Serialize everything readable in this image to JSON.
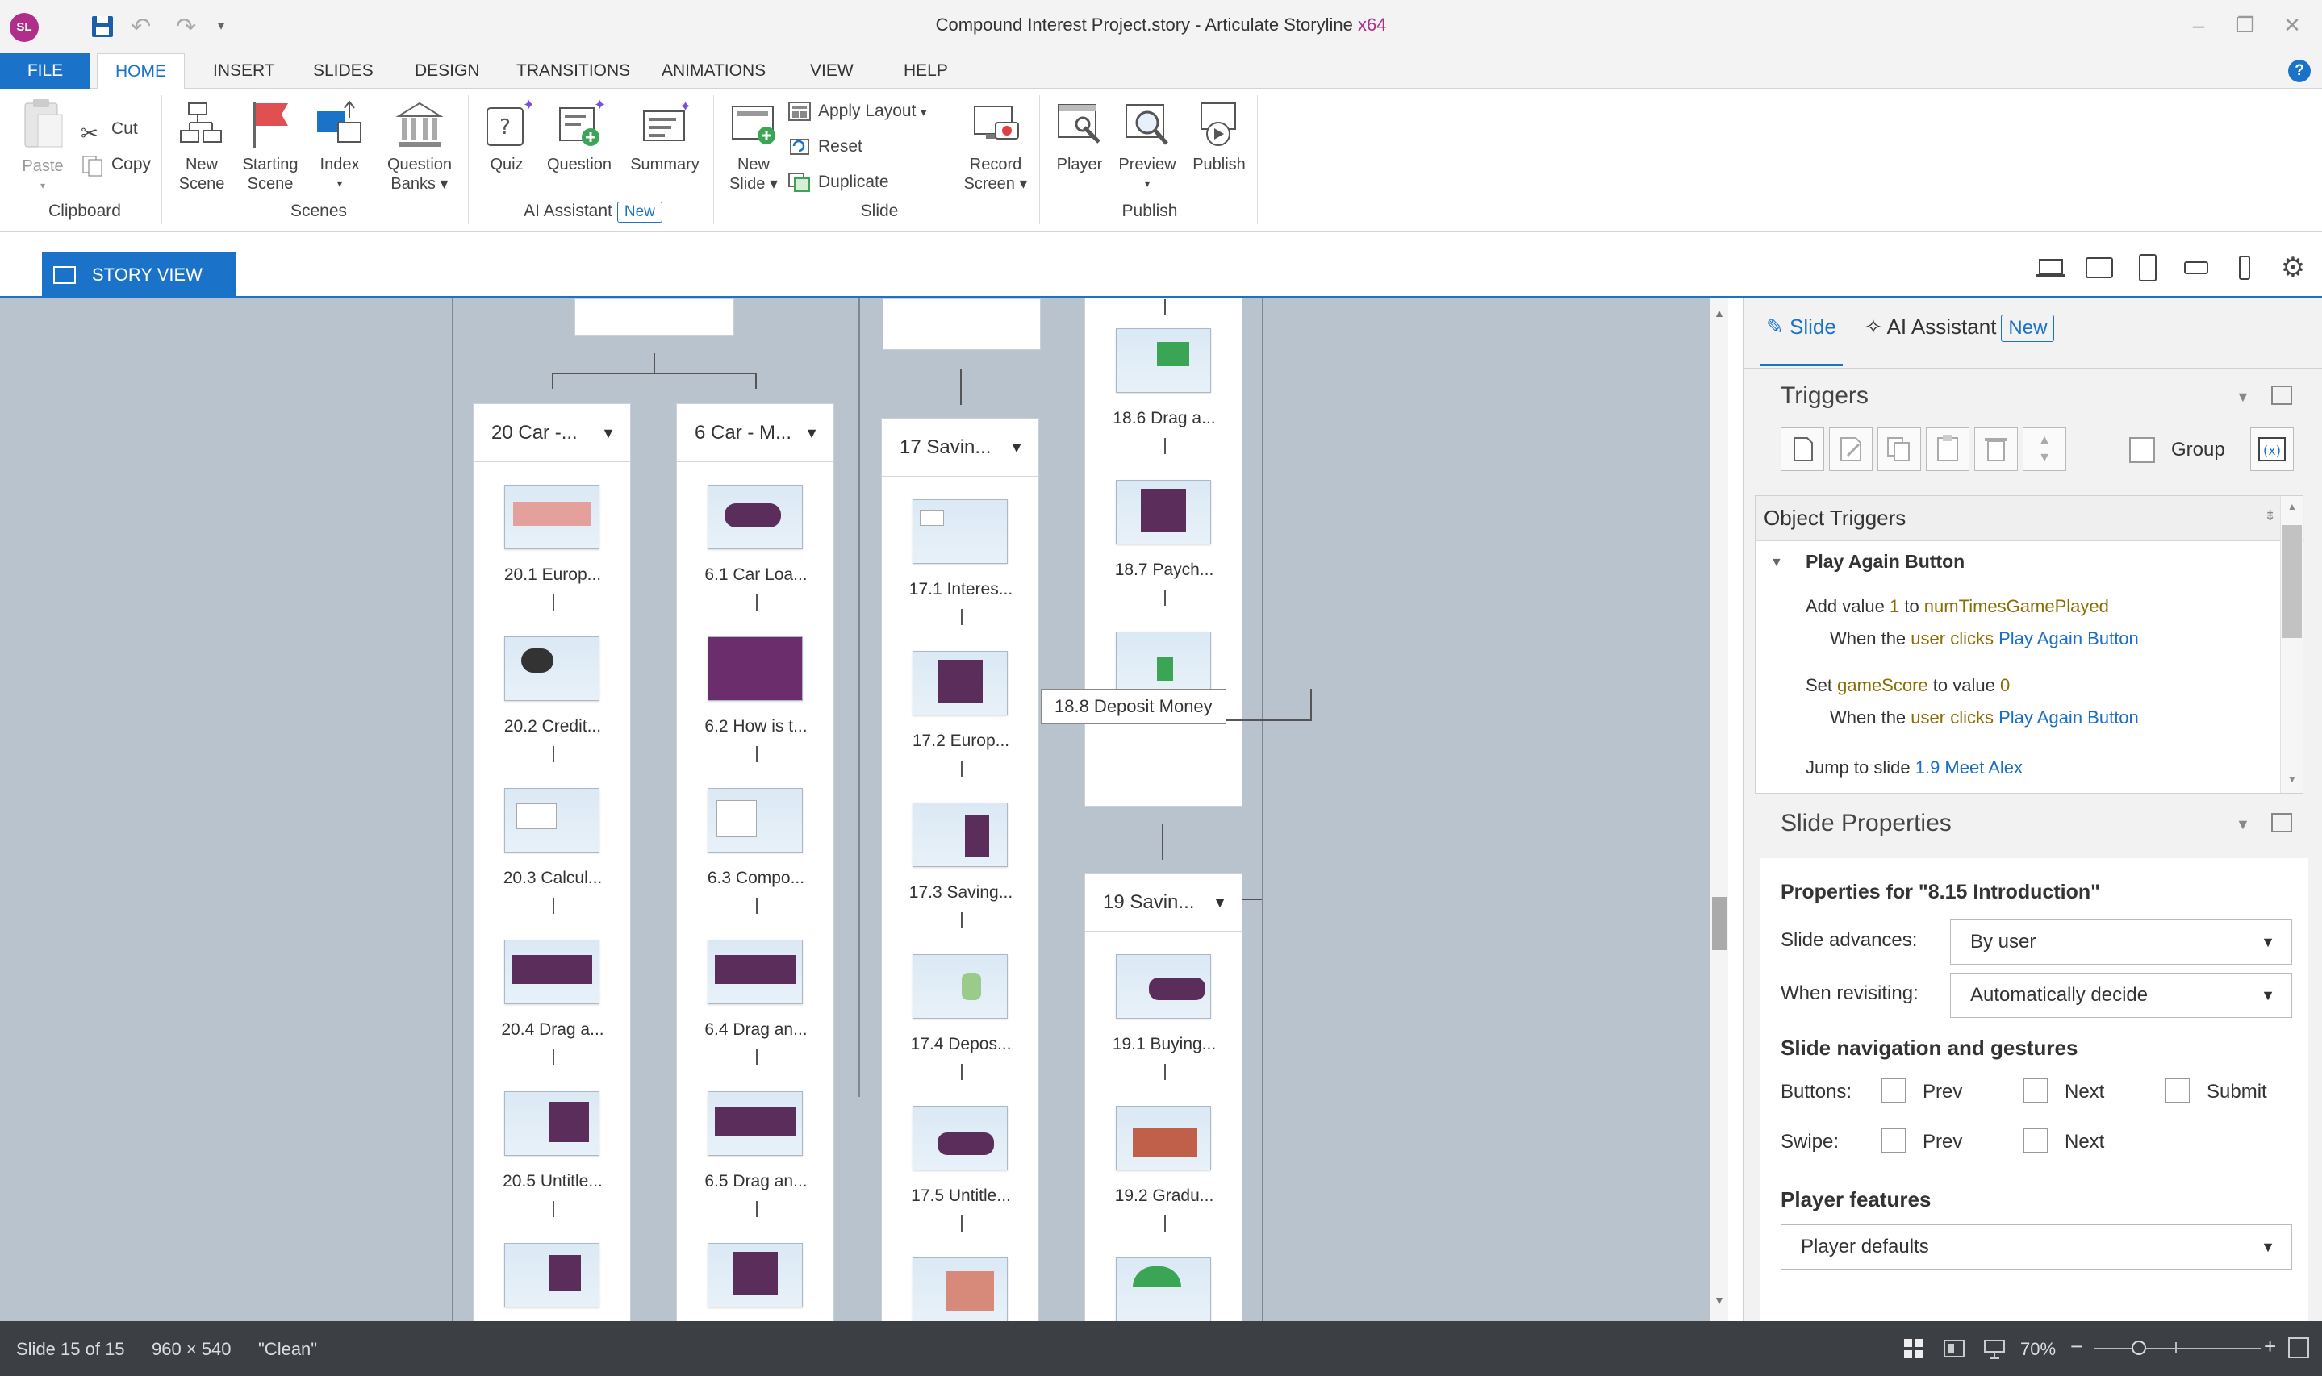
{
  "app": {
    "logo_text": "SL",
    "title_main": "Compound Interest Project.story - ",
    "title_app": "Articulate Storyline ",
    "title_arch": "x64",
    "accent": "#1a73c9",
    "brand": "#b12d8a"
  },
  "tabs": {
    "file": "FILE",
    "home": "HOME",
    "insert": "INSERT",
    "slides": "SLIDES",
    "design": "DESIGN",
    "transitions": "TRANSITIONS",
    "animations": "ANIMATIONS",
    "view": "VIEW",
    "help": "HELP"
  },
  "ribbon": {
    "clipboard": {
      "paste": "Paste",
      "cut": "Cut",
      "copy": "Copy",
      "label": "Clipboard"
    },
    "scenes": {
      "new1": "New",
      "new2": "Scene",
      "start1": "Starting",
      "start2": "Scene",
      "index": "Index",
      "qb1": "Question",
      "qb2": "Banks",
      "label": "Scenes"
    },
    "ai": {
      "quiz": "Quiz",
      "question": "Question",
      "summary": "Summary",
      "label": "AI Assistant",
      "badge": "New"
    },
    "slide": {
      "new1": "New",
      "new2": "Slide",
      "apply_layout": "Apply Layout",
      "reset": "Reset",
      "duplicate": "Duplicate",
      "record1": "Record",
      "record2": "Screen",
      "label": "Slide"
    },
    "publish": {
      "player": "Player",
      "preview": "Preview",
      "publish": "Publish",
      "label": "Publish"
    }
  },
  "viewtab": {
    "story_view": "STORY VIEW"
  },
  "scenes": [
    {
      "title": "20 Car -...",
      "slides": [
        "20.1 Europ...",
        "20.2 Credit...",
        "20.3 Calcul...",
        "20.4 Drag a...",
        "20.5 Untitle..."
      ]
    },
    {
      "title": "6 Car - M...",
      "slides": [
        "6.1 Car Loa...",
        "6.2 How is t...",
        "6.3 Compo...",
        "6.4 Drag an...",
        "6.5 Drag an..."
      ]
    },
    {
      "title": "17 Savin...",
      "slides": [
        "17.1 Interes...",
        "17.2 Europ...",
        "17.3 Saving...",
        "17.4 Depos...",
        "17.5 Untitle..."
      ]
    },
    {
      "title": "",
      "slides": [
        "18.6 Drag a...",
        "18.7 Paych..."
      ]
    },
    {
      "title": "19 Savin...",
      "slides": [
        "19.1  Buying...",
        "19.2 Gradu..."
      ]
    }
  ],
  "tooltip": "18.8 Deposit Money",
  "panel": {
    "tab_slide": "Slide",
    "tab_ai": "AI Assistant",
    "tab_ai_badge": "New",
    "triggers_title": "Triggers",
    "group_label": "Group",
    "object_triggers": "Object Triggers",
    "object_name": "Play Again Button",
    "t1_action": "Add value ",
    "t1_num": "1",
    "t1_to": " to ",
    "t1_var": "numTimesGamePlayed",
    "t1_when": "When the ",
    "t1_user": "user clicks",
    "t1_obj": "Play Again Button",
    "t2_action": "Set ",
    "t2_var": "gameScore",
    "t2_to": " to value ",
    "t2_num": "0",
    "t2_when": "When the ",
    "t2_user": "user clicks",
    "t2_obj": "Play Again Button",
    "t3_action": "Jump to slide ",
    "t3_target": "1.9 Meet Alex",
    "slide_props_title": "Slide Properties",
    "props_for": "Properties for \"8.15 Introduction\"",
    "slide_advances_label": "Slide advances:",
    "slide_advances_value": "By user",
    "when_revisiting_label": "When revisiting:",
    "when_revisiting_value": "Automatically decide",
    "nav_title": "Slide navigation and gestures",
    "buttons_label": "Buttons:",
    "swipe_label": "Swipe:",
    "prev": "Prev",
    "next": "Next",
    "submit": "Submit",
    "player_features": "Player features",
    "player_defaults": "Player defaults"
  },
  "status": {
    "slide_count": "Slide 15 of 15",
    "dims": "960 × 540",
    "theme": "\"Clean\"",
    "zoom": "70%"
  }
}
